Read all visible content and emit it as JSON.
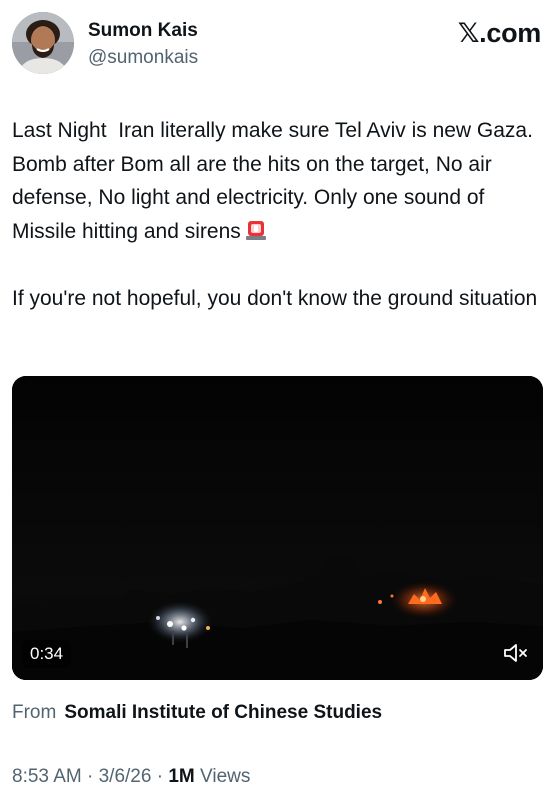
{
  "author": {
    "name": "Sumon Kais",
    "handle": "@sumonkais"
  },
  "brand": {
    "x_glyph": "𝕏",
    "suffix": ".com"
  },
  "tweet": {
    "text_line_1": "Last Night  Iran literally make sure Tel Aviv is new Gaza. Bomb after Bom all are the hits on the target, No air defense, No light and electricity. Only one sound of Missile hitting and sirens",
    "text_line_1_emoji": "police-car-light-icon",
    "text_line_2": "If you're not hopeful, you don't know the ground situation"
  },
  "video": {
    "duration": "0:34",
    "mute_icon": "speaker-muted-icon"
  },
  "source": {
    "prefix": "From",
    "name": "Somali Institute of Chinese Studies"
  },
  "meta": {
    "time": "8:53 AM",
    "sep1": " · ",
    "date": "3/6/26",
    "sep2": " · ",
    "views_count": "1M",
    "views_label": " Views"
  },
  "colors": {
    "text_primary": "#0f1419",
    "text_secondary": "#536471",
    "video_bg": "#050505",
    "fire": "#ff6a1f"
  }
}
